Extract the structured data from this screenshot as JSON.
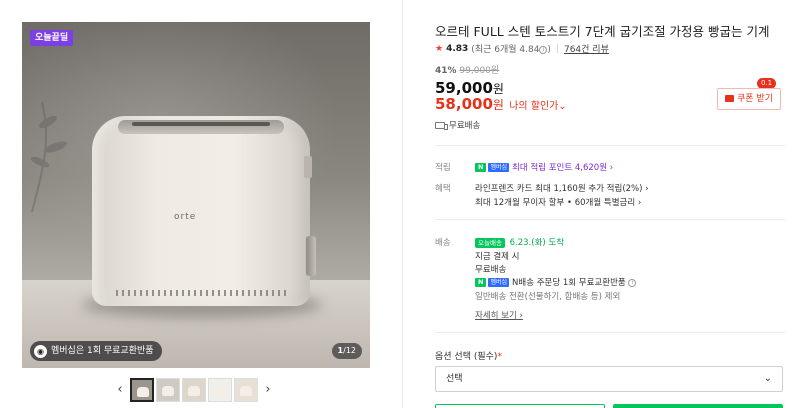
{
  "gallery": {
    "today_badge": "오늘끝딜",
    "brand_on_product": "orte",
    "membership_chip": "멤버십은 1회 무료교환반품",
    "image_counter_current": "1",
    "image_counter_total": "/12",
    "prev_arrow": "‹",
    "next_arrow": "›",
    "thumb_count": 5
  },
  "product": {
    "title": "오르테 FULL 스텐 토스트기 7단계 굽기조절 가정용 빵굽는 기계",
    "rating_star": "★",
    "rating_score": "4.83",
    "rating_recent": "(최근 6개월 4.84",
    "rating_recent_close": ")",
    "review_count": "764건 리뷰",
    "discount_pct": "41%",
    "original_price": "99,000원",
    "price_number": "59,000",
    "price_unit": "원",
    "my_price_number": "58,000",
    "my_price_unit": "원",
    "my_price_label": "나의 할인가",
    "my_price_chevron": "⌄",
    "coupon_label": "쿠폰 받기",
    "coupon_badge": "0.1",
    "free_shipping": "무료배송"
  },
  "benefits": {
    "points_label": "적립",
    "points_npay": "N",
    "points_membership": "멤버십",
    "points_text": "최대 적립 포인트 4,620원",
    "points_arrow": "›",
    "perks_label": "혜택",
    "perk_1": "라인프렌즈 카드 최대 1,160원 추가 적립(2%)",
    "perk_1_arrow": "›",
    "perk_2": "최대 12개월 무이자 할부 • 60개월 특별금리",
    "perk_2_arrow": "›"
  },
  "delivery": {
    "label": "배송",
    "today_tag": "오늘배송",
    "arrival": "6.23.(화) 도착",
    "pay_time": "지금 결제 시",
    "free": "무료배송",
    "npay": "N",
    "membership": "멤버십",
    "exchange_text": "N배송 주문당 1회 무료교환반품",
    "note": "일반배송 전환(선물하기, 합배송 등) 제외",
    "detail_link": "자세히 보기",
    "detail_arrow": "›"
  },
  "options": {
    "label": "옵션 선택 (필수)",
    "required_mark": "*",
    "select_value": "선택",
    "chevron": "⌄"
  },
  "colors": {
    "accent_red": "#e8311a",
    "naver_green": "#03c75a",
    "badge_purple": "#7b3fe4"
  }
}
